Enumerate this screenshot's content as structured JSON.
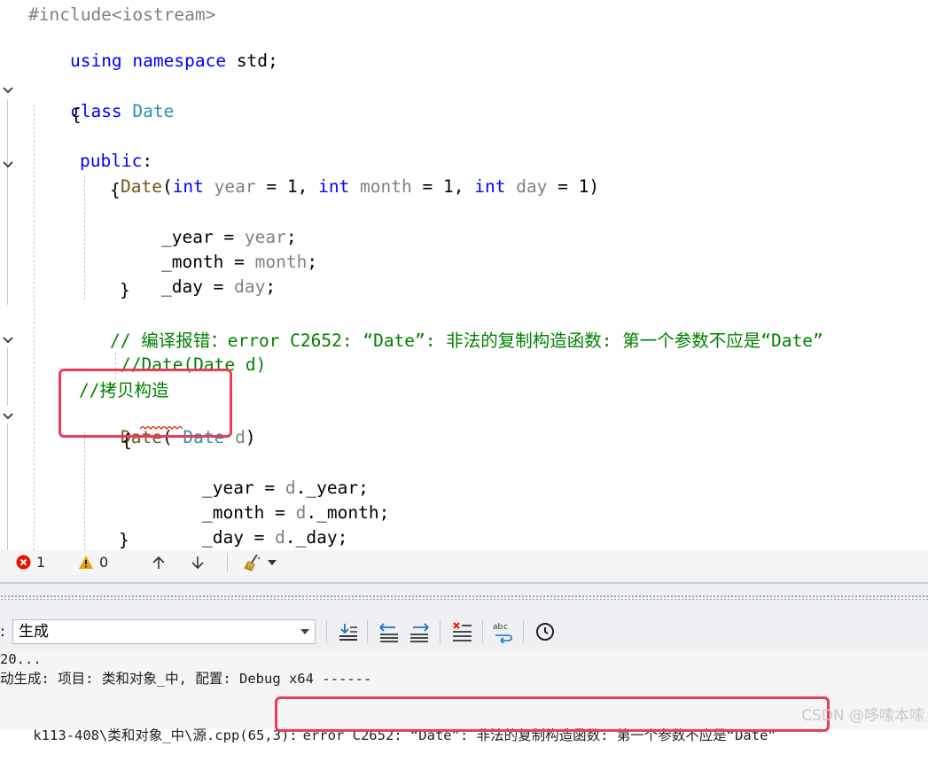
{
  "editor": {
    "lines": {
      "l1": "#include<iostream>",
      "l2_kw": "using namespace",
      "l2_rest": " std;",
      "l4_kw": "class",
      "l4_name": "Date",
      "l5": "{",
      "l6_kw": "public",
      "l6_colon": ":",
      "l7_fn": "Date",
      "l7_open": "(",
      "l7_int1": "int",
      "l7_p1": " year",
      "l7_eq1": " = 1, ",
      "l7_int2": "int",
      "l7_p2": " month",
      "l7_eq2": " = 1, ",
      "l7_int3": "int",
      "l7_p3": " day",
      "l7_eq3": " = 1)",
      "l8": "{",
      "l9_a": "_year = ",
      "l9_b": "year",
      "l9_c": ";",
      "l10_a": "_month = ",
      "l10_b": "month",
      "l10_c": ";",
      "l11_a": "_day = ",
      "l11_b": "day",
      "l11_c": ";",
      "l12": "}",
      "l14": "// 编译报错：error C2652: “Date”: 非法的复制构造函数: 第一个参数不应是“Date”",
      "l15": "//Date(Date d)",
      "l16": "//拷贝构造",
      "l17_fn": "Date",
      "l17_open": "( ",
      "l17_ty": "Date",
      "l17_p": " d",
      "l17_close": ")",
      "l18": "{",
      "l19_a": "_year = ",
      "l19_b": "d",
      "l19_c": "._year;",
      "l20_a": "_month = ",
      "l20_b": "d",
      "l20_c": "._month;",
      "l21_a": "_day = ",
      "l21_b": "d",
      "l21_c": "._day;",
      "l22": "}"
    }
  },
  "status": {
    "errors": "1",
    "warnings": "0"
  },
  "output": {
    "source_label": "生成",
    "line1": "20...",
    "line2": "动生成: 项目: 类和对象_中, 配置: Debug x64 ------",
    "line3_path": "k113-408\\类和对象_中\\源.cpp(65,3):",
    "line3_error": "error C2652: “Date”: 非法的复制构造函数: 第一个参数不应是“Date”"
  },
  "watermark": "CSDN @哆嗦本嗦",
  "colors": {
    "keyword": "#0000ff",
    "type": "#2b91af",
    "function": "#74531f",
    "comment": "#008000",
    "highlight_box": "#e83e5a"
  }
}
